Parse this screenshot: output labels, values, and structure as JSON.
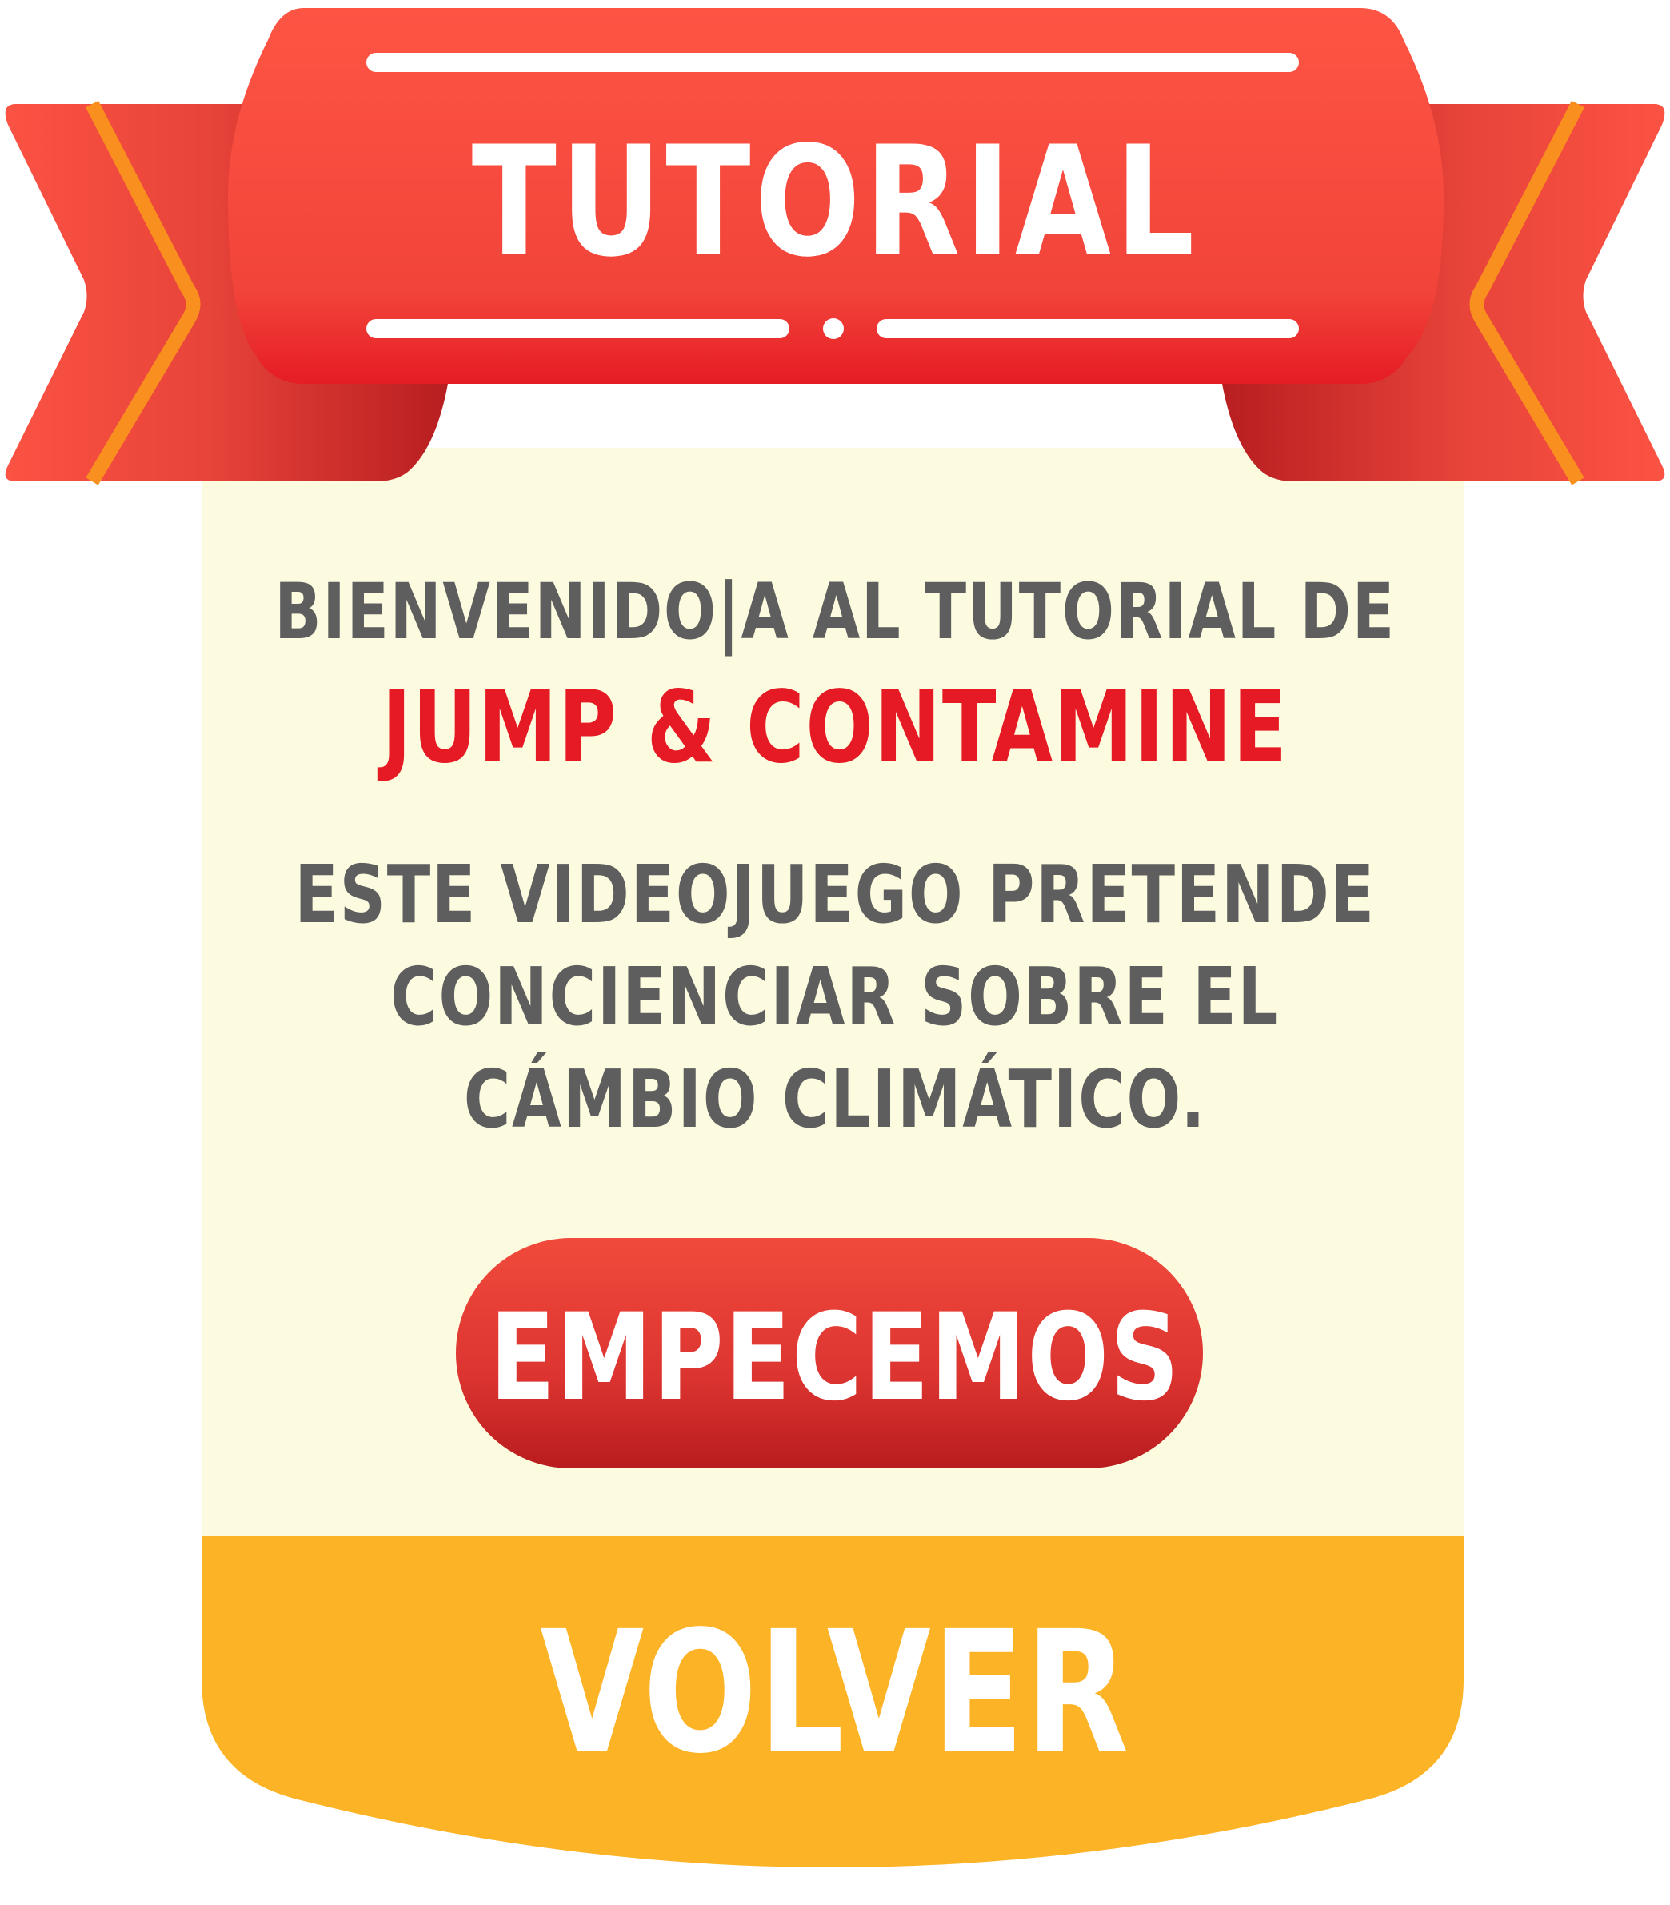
{
  "banner": {
    "title": "TUTORIAL"
  },
  "intro": {
    "welcome_line": "BIENVENIDO|A AL TUTORIAL DE",
    "game_name": "JUMP & CONTAMINE",
    "description_lines": [
      "ESTE VIDEOJUEGO PRETENDE",
      "CONCIENCIAR SOBRE EL",
      "CÁMBIO CLIMÁTICO."
    ]
  },
  "buttons": {
    "start_label": "EMPECEMOS",
    "back_label": "VOLVER"
  },
  "colors": {
    "ribbon_red": "#f7503d",
    "ribbon_dark": "#c02021",
    "ribbon_stripe": "#f98f1f",
    "panel_cream": "#fcfbdf",
    "footer_yellow": "#fcb426",
    "title_red": "#e51a24",
    "text_gray": "#5e5e5e"
  }
}
